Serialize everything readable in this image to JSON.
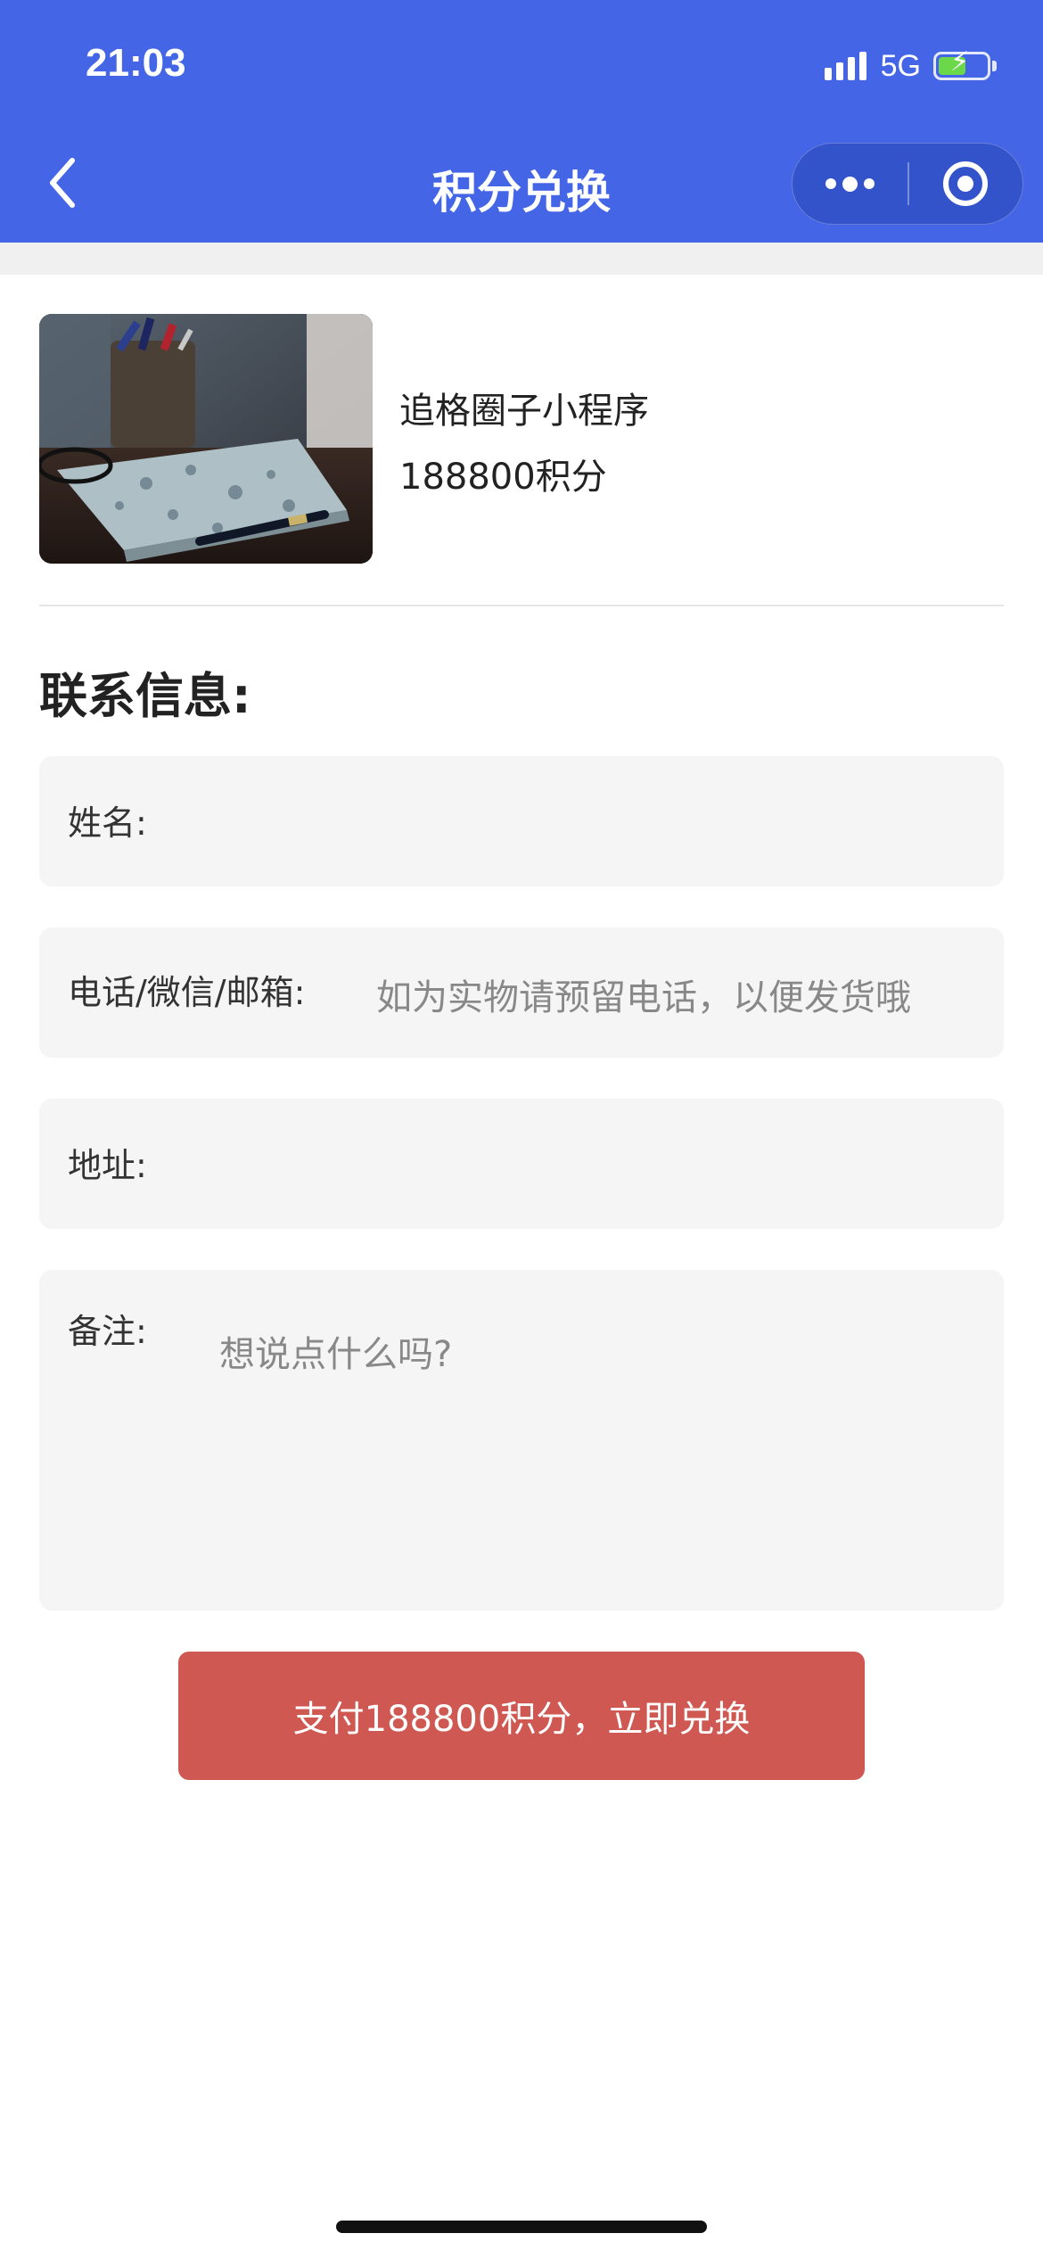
{
  "status_bar": {
    "time": "21:03",
    "network": "5G"
  },
  "nav": {
    "title": "积分兑换"
  },
  "product": {
    "name": "追格圈子小程序",
    "points": "188800积分"
  },
  "form": {
    "section_title": "联系信息:",
    "name": {
      "label": "姓名:",
      "value": ""
    },
    "contact": {
      "label": "电话/微信/邮箱:",
      "placeholder": "如为实物请预留电话，以便发货哦"
    },
    "address": {
      "label": "地址:",
      "value": ""
    },
    "remark": {
      "label": "备注:",
      "placeholder": "想说点什么吗?"
    }
  },
  "submit_label": "支付188800积分，立即兑换",
  "colors": {
    "nav_bg": "#4466e6",
    "submit_bg": "#cf5952",
    "field_bg": "#f5f5f5"
  }
}
